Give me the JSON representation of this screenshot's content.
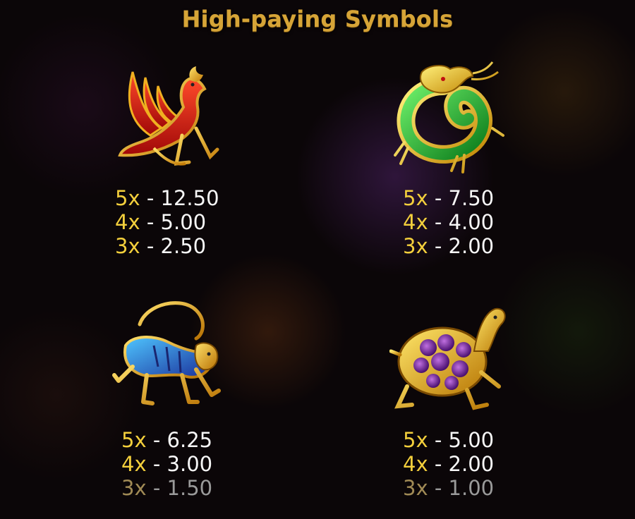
{
  "title": "High-paying Symbols",
  "colors": {
    "title": "#d6a437",
    "multiplier": "#f3cf3c",
    "value": "#f7f7f7",
    "dimmed": "#9a9a9a"
  },
  "symbols": [
    {
      "name": "phoenix",
      "icon": "phoenix-icon",
      "pays": [
        {
          "mult": "5x",
          "sep": "-",
          "value": "12.50"
        },
        {
          "mult": "4x",
          "sep": "-",
          "value": "5.00"
        },
        {
          "mult": "3x",
          "sep": "-",
          "value": "2.50"
        }
      ]
    },
    {
      "name": "dragon",
      "icon": "dragon-icon",
      "pays": [
        {
          "mult": "5x",
          "sep": "-",
          "value": "7.50"
        },
        {
          "mult": "4x",
          "sep": "-",
          "value": "4.00"
        },
        {
          "mult": "3x",
          "sep": "-",
          "value": "2.00"
        }
      ]
    },
    {
      "name": "tiger",
      "icon": "tiger-icon",
      "pays": [
        {
          "mult": "5x",
          "sep": "-",
          "value": "6.25"
        },
        {
          "mult": "4x",
          "sep": "-",
          "value": "3.00"
        },
        {
          "mult": "3x",
          "sep": "-",
          "value": "1.50"
        }
      ]
    },
    {
      "name": "turtle",
      "icon": "turtle-icon",
      "pays": [
        {
          "mult": "5x",
          "sep": "-",
          "value": "5.00"
        },
        {
          "mult": "4x",
          "sep": "-",
          "value": "2.00"
        },
        {
          "mult": "3x",
          "sep": "-",
          "value": "1.00"
        }
      ]
    }
  ]
}
